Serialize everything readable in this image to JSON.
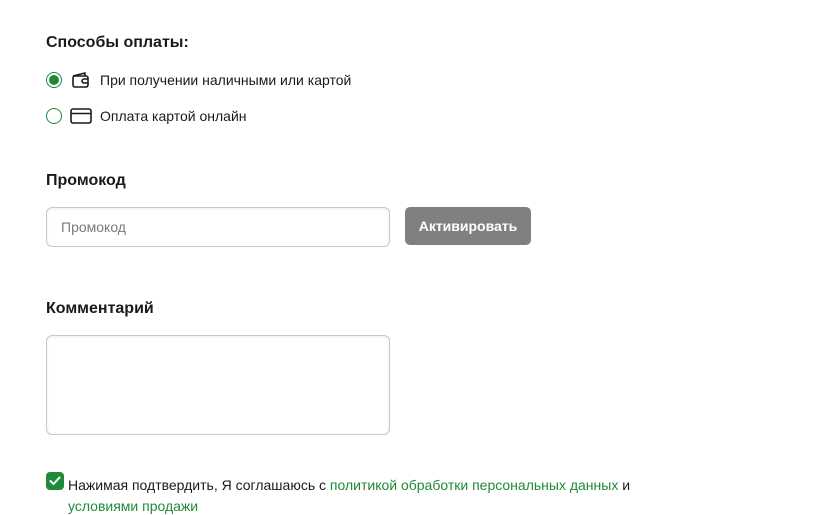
{
  "payment": {
    "title": "Способы оплаты:",
    "options": [
      {
        "label": "При получении наличными или картой",
        "icon": "wallet-icon",
        "selected": true
      },
      {
        "label": "Оплата картой онлайн",
        "icon": "credit-card-icon",
        "selected": false
      }
    ]
  },
  "promo": {
    "title": "Промокод",
    "placeholder": "Промокод",
    "value": "",
    "button_label": "Активировать"
  },
  "comment": {
    "title": "Комментарий",
    "value": ""
  },
  "agreement": {
    "checked": true,
    "text_before": "Нажимая подтвердить, Я соглашаюсь с ",
    "link_privacy": "политикой обработки персональных данных",
    "text_middle": " и ",
    "link_terms": "условиями продажи"
  },
  "colors": {
    "accent": "#1f8a3a",
    "button_disabled": "#808080",
    "text": "#1a1a1a"
  }
}
